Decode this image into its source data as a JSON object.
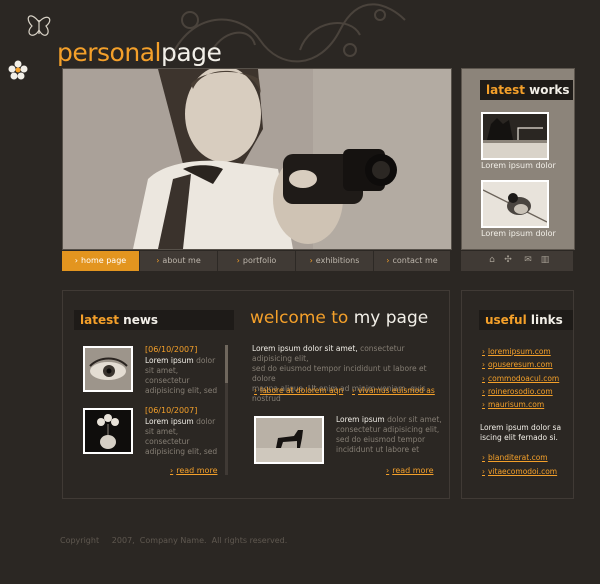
{
  "brand": {
    "part1": "personal",
    "part2": "page"
  },
  "nav": [
    {
      "label": "home page",
      "active": true
    },
    {
      "label": "about me",
      "active": false
    },
    {
      "label": "portfolio",
      "active": false
    },
    {
      "label": "exhibitions",
      "active": false
    },
    {
      "label": "contact me",
      "active": false
    }
  ],
  "works": {
    "title_a": "latest",
    "title_b": "works",
    "items": [
      {
        "caption": "Lorem ipsum dolor"
      },
      {
        "caption": "Lorem ipsum dolor"
      }
    ]
  },
  "icons": [
    "home-icon",
    "sitemap-icon",
    "mail-icon",
    "trash-icon"
  ],
  "news": {
    "title_a": "latest",
    "title_b": "news",
    "items": [
      {
        "date": "[06/10/2007]",
        "lead": "Lorem ipsum",
        "line1": "dolor",
        "line2": "sit amet, consectetur",
        "line3": "adipisicing elit, sed"
      },
      {
        "date": "[06/10/2007]",
        "lead": "Lorem ipsum",
        "line1": "dolor",
        "line2": "sit amet, consectetur",
        "line3": "adipisicing elit, sed"
      }
    ],
    "more": "read more"
  },
  "welcome": {
    "title_a": "welcome to",
    "title_b": "my page",
    "p1_lead": "Lorem ipsum dolor sit amet,",
    "p1_rest1": "consectetur adipisicing elit,",
    "p1_line2": "sed do eiusmod tempor incididunt ut labore et dolore",
    "p1_line3": "magna aliqua. Ut enim ad minim veniam, quis nostrud",
    "link1": "labore at dolorem aqn",
    "link2": "vivamus euismod as",
    "p2_lead": "Lorem ipsum",
    "p2_rest1": "dolor sit amet,",
    "p2_line2": "consectetur adipisicing elit,",
    "p2_line3": "sed do eiusmod tempor",
    "p2_line4": "incididunt ut labore et",
    "more": "read more"
  },
  "useful": {
    "title_a": "useful",
    "title_b": "links",
    "links1": [
      "loremipsum.com",
      "opuseresum.com",
      "commodoacul.com",
      "roinerosodio.com",
      "maurisum.com"
    ],
    "text1": "Lorem ipsum dolor sa",
    "text2": "iscing elit fernado si.",
    "links2": [
      "blanditerat.com",
      "vitaecomodoi.com"
    ]
  },
  "footer": {
    "text": "Copyright     2007,  Company Name.  All rights reserved."
  },
  "colors": {
    "accent": "#f4a02a",
    "background": "#2b2723"
  }
}
